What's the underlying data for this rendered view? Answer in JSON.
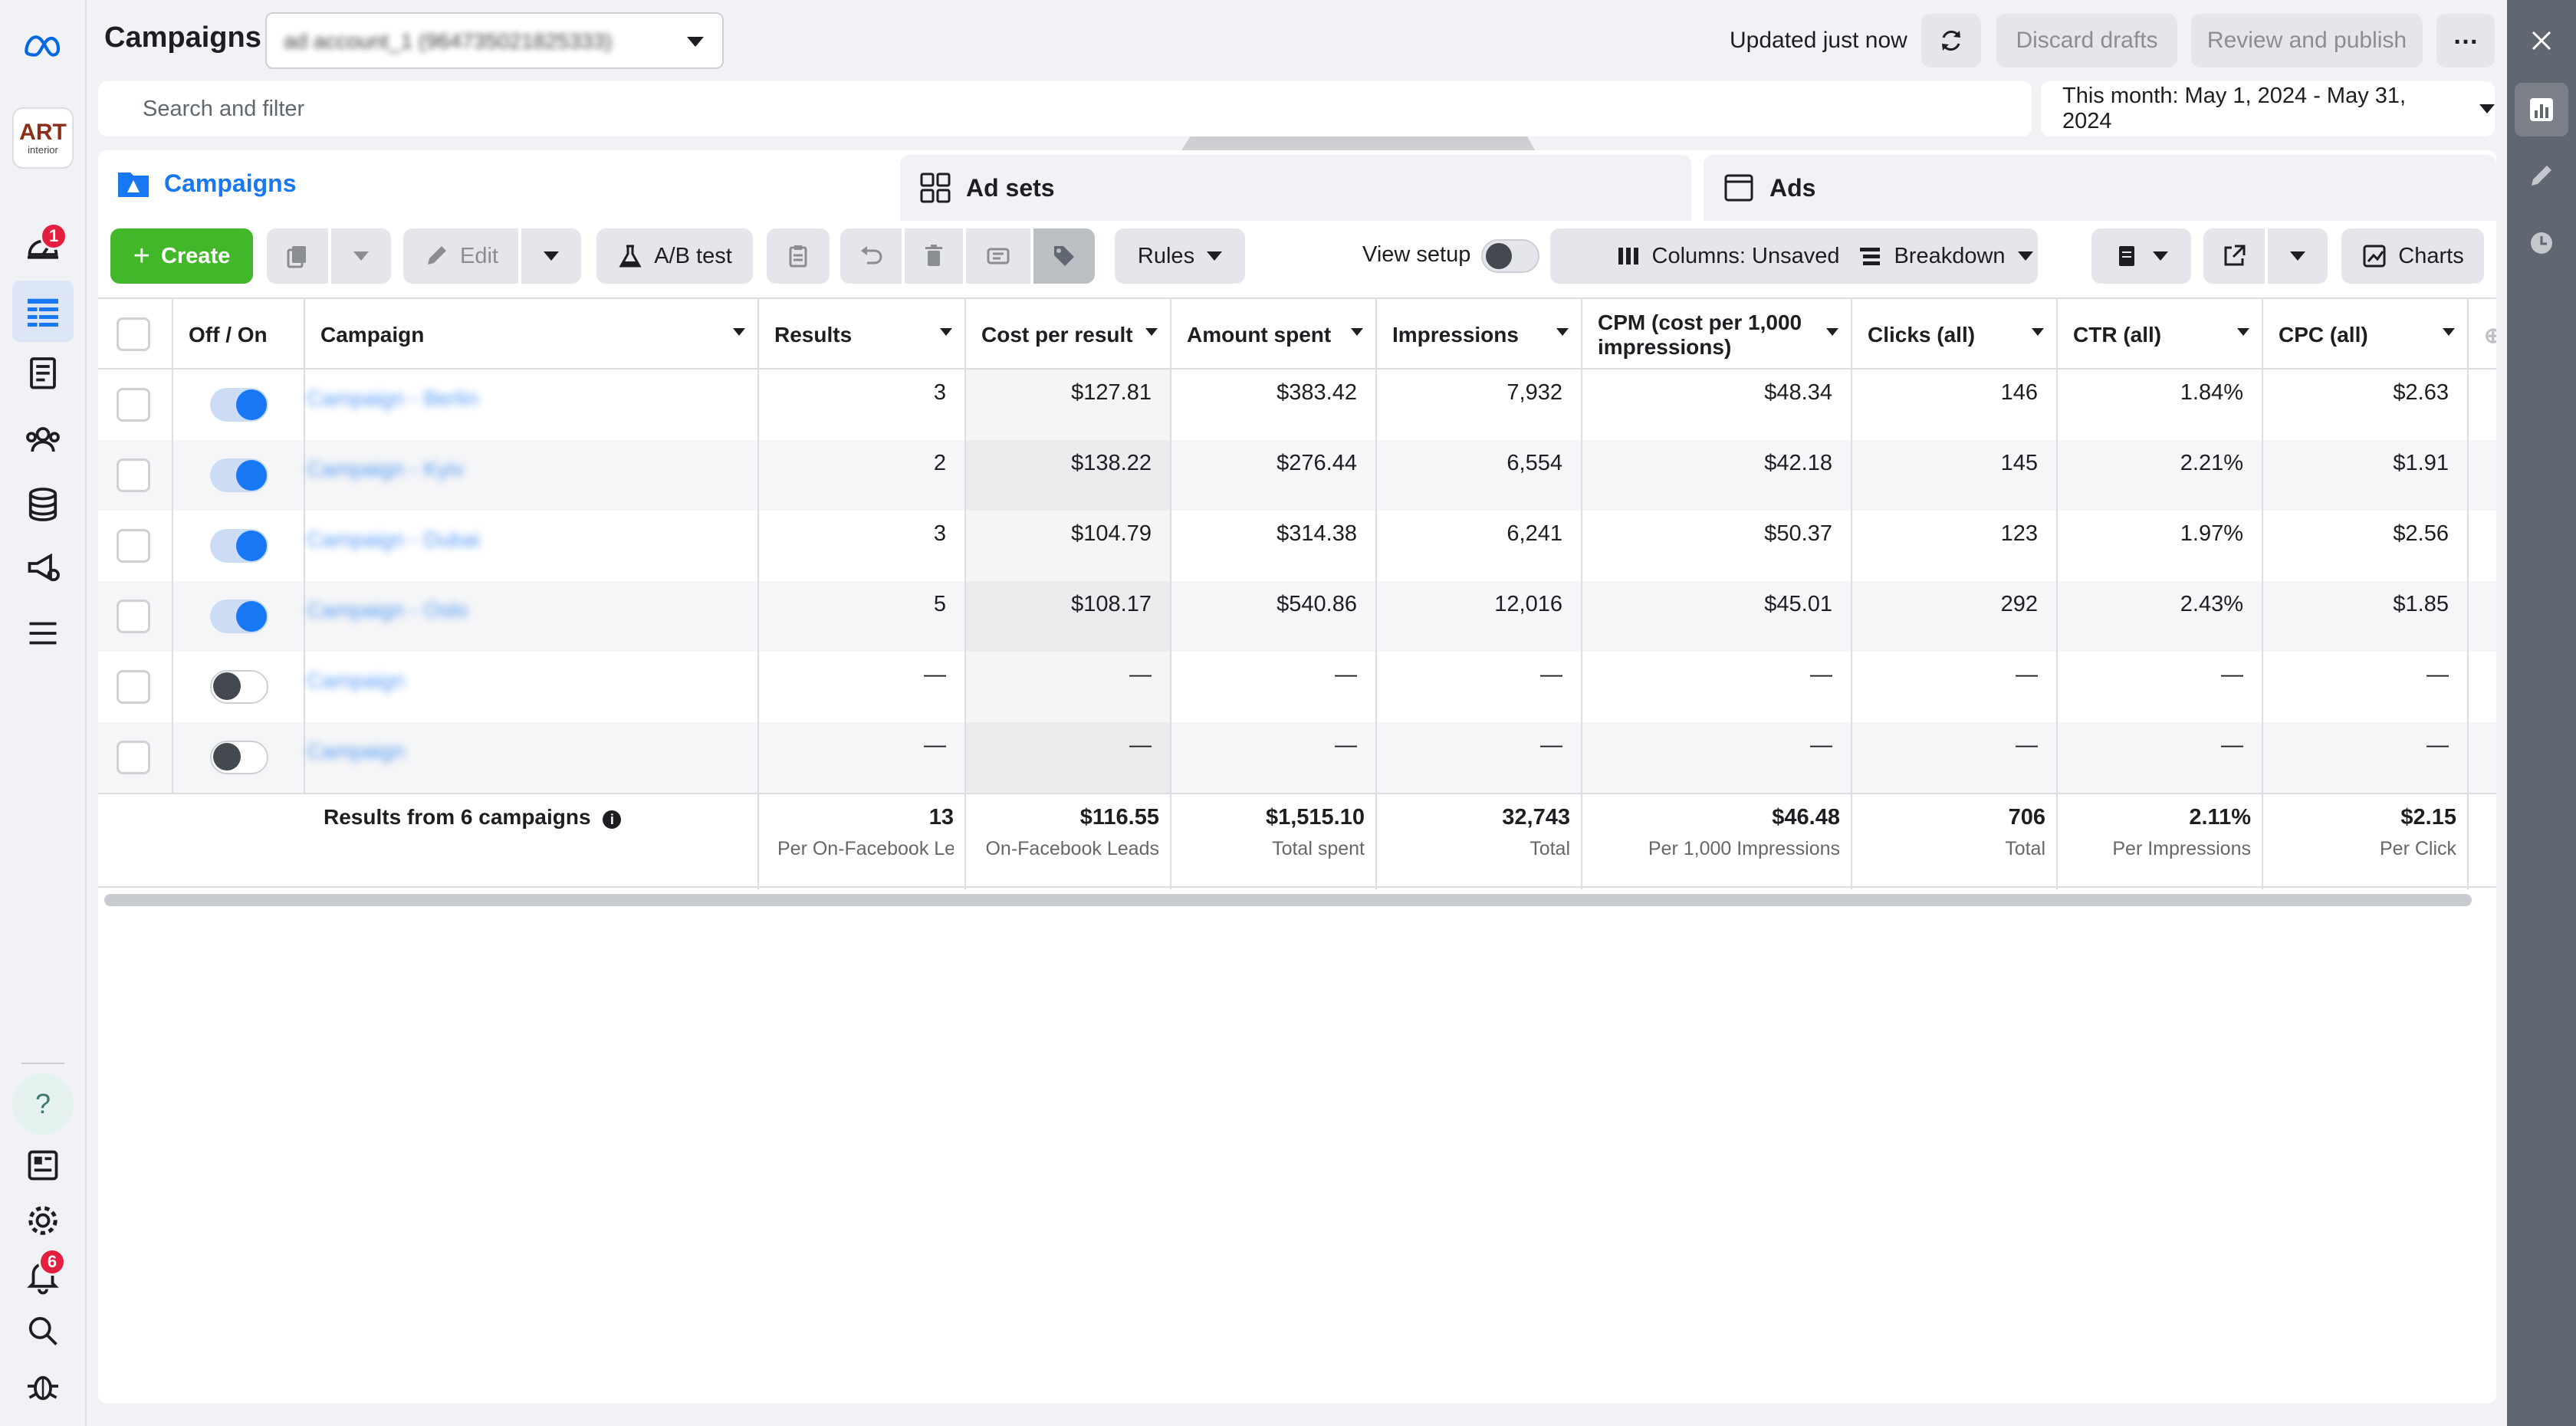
{
  "topbar": {
    "title": "Campaigns",
    "account_selector": "ad account_1 (964735021825333)",
    "status": "Updated just now",
    "discard_label": "Discard drafts",
    "review_label": "Review and publish",
    "search_placeholder": "Search and filter",
    "date_range": "This month: May 1, 2024 - May 31, 2024"
  },
  "leftnav": {
    "logo_text": "ART",
    "logo_sub": "interior",
    "notifications_badge": "1",
    "alerts_badge": "6"
  },
  "tabs": [
    {
      "label": "Campaigns"
    },
    {
      "label": "Ad sets"
    },
    {
      "label": "Ads"
    }
  ],
  "toolbar": {
    "create": "Create",
    "edit": "Edit",
    "ab_test": "A/B test",
    "rules": "Rules",
    "view_setup": "View setup",
    "columns": "Columns: Unsaved",
    "breakdown": "Breakdown",
    "charts": "Charts"
  },
  "table": {
    "headers": {
      "off_on": "Off / On",
      "campaign": "Campaign",
      "results": "Results",
      "cost_per_result": "Cost per result",
      "amount_spent": "Amount spent",
      "impressions": "Impressions",
      "cpm": "CPM (cost per 1,000 impressions)",
      "clicks": "Clicks (all)",
      "ctr": "CTR (all)",
      "cpc": "CPC (all)"
    },
    "rows": [
      {
        "on": true,
        "name": "Campaign - Berlin",
        "results": "3",
        "cpr": "$127.81",
        "spent": "$383.42",
        "impr": "7,932",
        "cpm": "$48.34",
        "clicks": "146",
        "ctr": "1.84%",
        "cpc": "$2.63"
      },
      {
        "on": true,
        "name": "Campaign - Kyiv",
        "results": "2",
        "cpr": "$138.22",
        "spent": "$276.44",
        "impr": "6,554",
        "cpm": "$42.18",
        "clicks": "145",
        "ctr": "2.21%",
        "cpc": "$1.91"
      },
      {
        "on": true,
        "name": "Campaign - Dubai",
        "results": "3",
        "cpr": "$104.79",
        "spent": "$314.38",
        "impr": "6,241",
        "cpm": "$50.37",
        "clicks": "123",
        "ctr": "1.97%",
        "cpc": "$2.56"
      },
      {
        "on": true,
        "name": "Campaign - Oslo",
        "results": "5",
        "cpr": "$108.17",
        "spent": "$540.86",
        "impr": "12,016",
        "cpm": "$45.01",
        "clicks": "292",
        "ctr": "2.43%",
        "cpc": "$1.85"
      },
      {
        "on": false,
        "name": "Campaign",
        "results": "—",
        "cpr": "—",
        "spent": "—",
        "impr": "—",
        "cpm": "—",
        "clicks": "—",
        "ctr": "—",
        "cpc": "—"
      },
      {
        "on": false,
        "name": "Campaign",
        "results": "—",
        "cpr": "—",
        "spent": "—",
        "impr": "—",
        "cpm": "—",
        "clicks": "—",
        "ctr": "—",
        "cpc": "—"
      }
    ],
    "footer": {
      "label": "Results from 6 campaigns",
      "results": "13",
      "results_sub": "Per On-Facebook Le...",
      "cpr": "$116.55",
      "cpr_sub": "On-Facebook Leads",
      "spent": "$1,515.10",
      "spent_sub": "Total spent",
      "impr": "32,743",
      "impr_sub": "Total",
      "cpm": "$46.48",
      "cpm_sub": "Per 1,000 Impressions",
      "clicks": "706",
      "clicks_sub": "Total",
      "ctr": "2.11%",
      "ctr_sub": "Per Impressions",
      "cpc": "$2.15",
      "cpc_sub": "Per Click"
    }
  },
  "colors": {
    "accent": "#1877f2",
    "create": "#42b72a",
    "badge": "#e41e3f"
  }
}
